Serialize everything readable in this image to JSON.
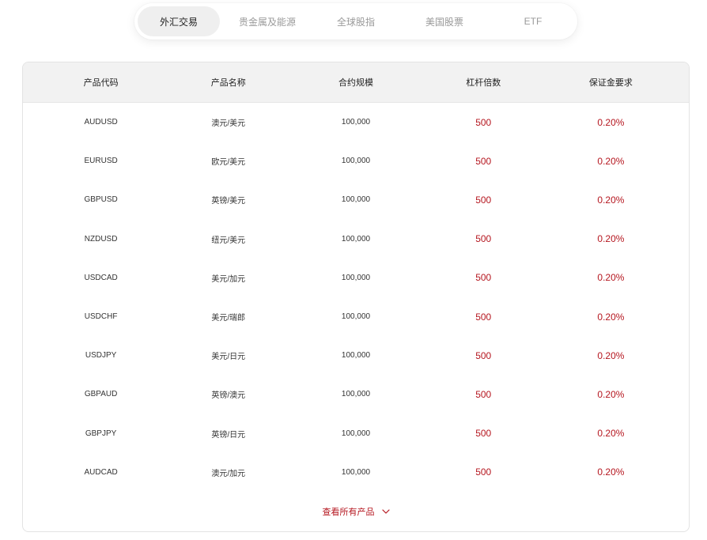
{
  "tabs": [
    {
      "label": "外汇交易",
      "active": true
    },
    {
      "label": "贵金属及能源",
      "active": false
    },
    {
      "label": "全球股指",
      "active": false
    },
    {
      "label": "美国股票",
      "active": false
    },
    {
      "label": "ETF",
      "active": false
    }
  ],
  "table": {
    "headers": [
      "产品代码",
      "产品名称",
      "合约规模",
      "杠杆倍数",
      "保证金要求"
    ],
    "rows": [
      {
        "code": "AUDUSD",
        "name": "澳元/美元",
        "contract_size": "100,000",
        "leverage": "500",
        "margin": "0.20%"
      },
      {
        "code": "EURUSD",
        "name": "欧元/美元",
        "contract_size": "100,000",
        "leverage": "500",
        "margin": "0.20%"
      },
      {
        "code": "GBPUSD",
        "name": "英镑/美元",
        "contract_size": "100,000",
        "leverage": "500",
        "margin": "0.20%"
      },
      {
        "code": "NZDUSD",
        "name": "纽元/美元",
        "contract_size": "100,000",
        "leverage": "500",
        "margin": "0.20%"
      },
      {
        "code": "USDCAD",
        "name": "美元/加元",
        "contract_size": "100,000",
        "leverage": "500",
        "margin": "0.20%"
      },
      {
        "code": "USDCHF",
        "name": "美元/瑞郎",
        "contract_size": "100,000",
        "leverage": "500",
        "margin": "0.20%"
      },
      {
        "code": "USDJPY",
        "name": "美元/日元",
        "contract_size": "100,000",
        "leverage": "500",
        "margin": "0.20%"
      },
      {
        "code": "GBPAUD",
        "name": "英镑/澳元",
        "contract_size": "100,000",
        "leverage": "500",
        "margin": "0.20%"
      },
      {
        "code": "GBPJPY",
        "name": "英镑/日元",
        "contract_size": "100,000",
        "leverage": "500",
        "margin": "0.20%"
      },
      {
        "code": "AUDCAD",
        "name": "澳元/加元",
        "contract_size": "100,000",
        "leverage": "500",
        "margin": "0.20%"
      }
    ]
  },
  "more": {
    "label": "查看所有产品",
    "icon": "chevron-down-icon"
  },
  "colors": {
    "accent": "#b5161f",
    "text": "#333333",
    "muted": "#9a9a9a",
    "header_bg": "#f2f2f2",
    "border": "#e3e3e3",
    "tab_active_bg": "#efefef"
  }
}
